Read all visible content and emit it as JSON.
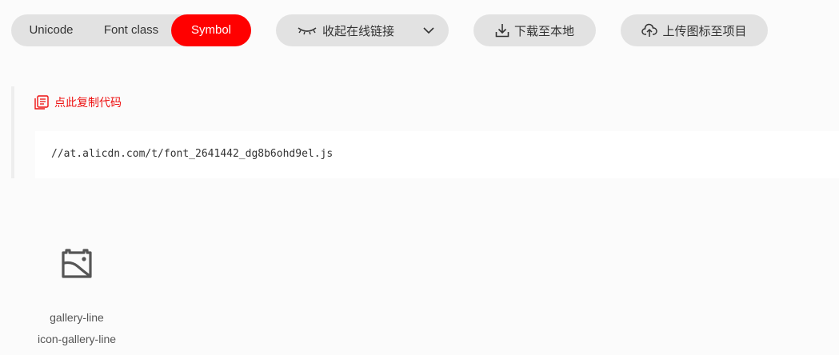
{
  "tabs": [
    {
      "label": "Unicode",
      "active": false
    },
    {
      "label": "Font class",
      "active": false
    },
    {
      "label": "Symbol",
      "active": true
    }
  ],
  "toolbar": {
    "collapse_label": "收起在线链接",
    "download_label": "下载至本地",
    "upload_label": "上传图标至项目"
  },
  "code": {
    "copy_label": "点此复制代码",
    "url": "//at.alicdn.com/t/font_2641442_dg8b6ohd9el.js"
  },
  "icons": [
    {
      "name": "gallery-line",
      "class": "icon-gallery-line",
      "icon": "gallery-line-icon"
    }
  ],
  "colors": {
    "accent": "#ff0000",
    "pill_bg": "#e2e2e2",
    "copy_text": "#ee1111"
  }
}
